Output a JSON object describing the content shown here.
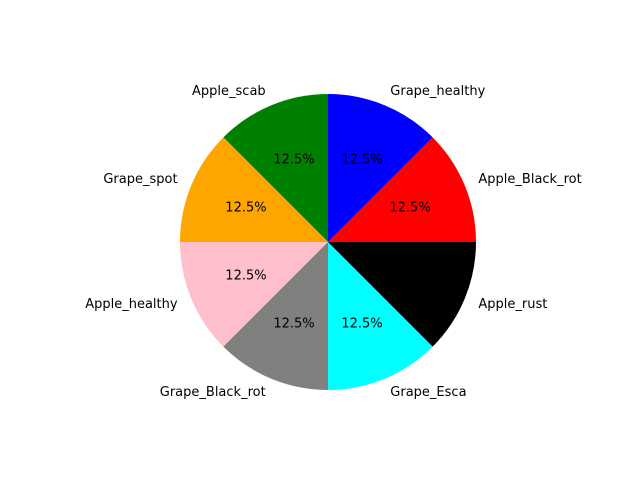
{
  "chart_data": {
    "type": "pie",
    "title": "",
    "start_angle_deg": 90,
    "direction": "counterclockwise",
    "slices": [
      {
        "label": "Apple_scab",
        "value": 12.5,
        "pct_label": "12.5%",
        "color": "#008000"
      },
      {
        "label": "Grape_spot",
        "value": 12.5,
        "pct_label": "12.5%",
        "color": "#FFA500"
      },
      {
        "label": "Apple_healthy",
        "value": 12.5,
        "pct_label": "12.5%",
        "color": "#FFC0CB"
      },
      {
        "label": "Grape_Black_rot",
        "value": 12.5,
        "pct_label": "12.5%",
        "color": "#808080"
      },
      {
        "label": "Grape_Esca",
        "value": 12.5,
        "pct_label": "12.5%",
        "color": "#00FFFF"
      },
      {
        "label": "Apple_rust",
        "value": 12.5,
        "pct_label": "12.5%",
        "color": "#000000"
      },
      {
        "label": "Apple_Black_rot",
        "value": 12.5,
        "pct_label": "12.5%",
        "color": "#FF0000"
      },
      {
        "label": "Grape_healthy",
        "value": 12.5,
        "pct_label": "12.5%",
        "color": "#0000FF"
      }
    ]
  }
}
